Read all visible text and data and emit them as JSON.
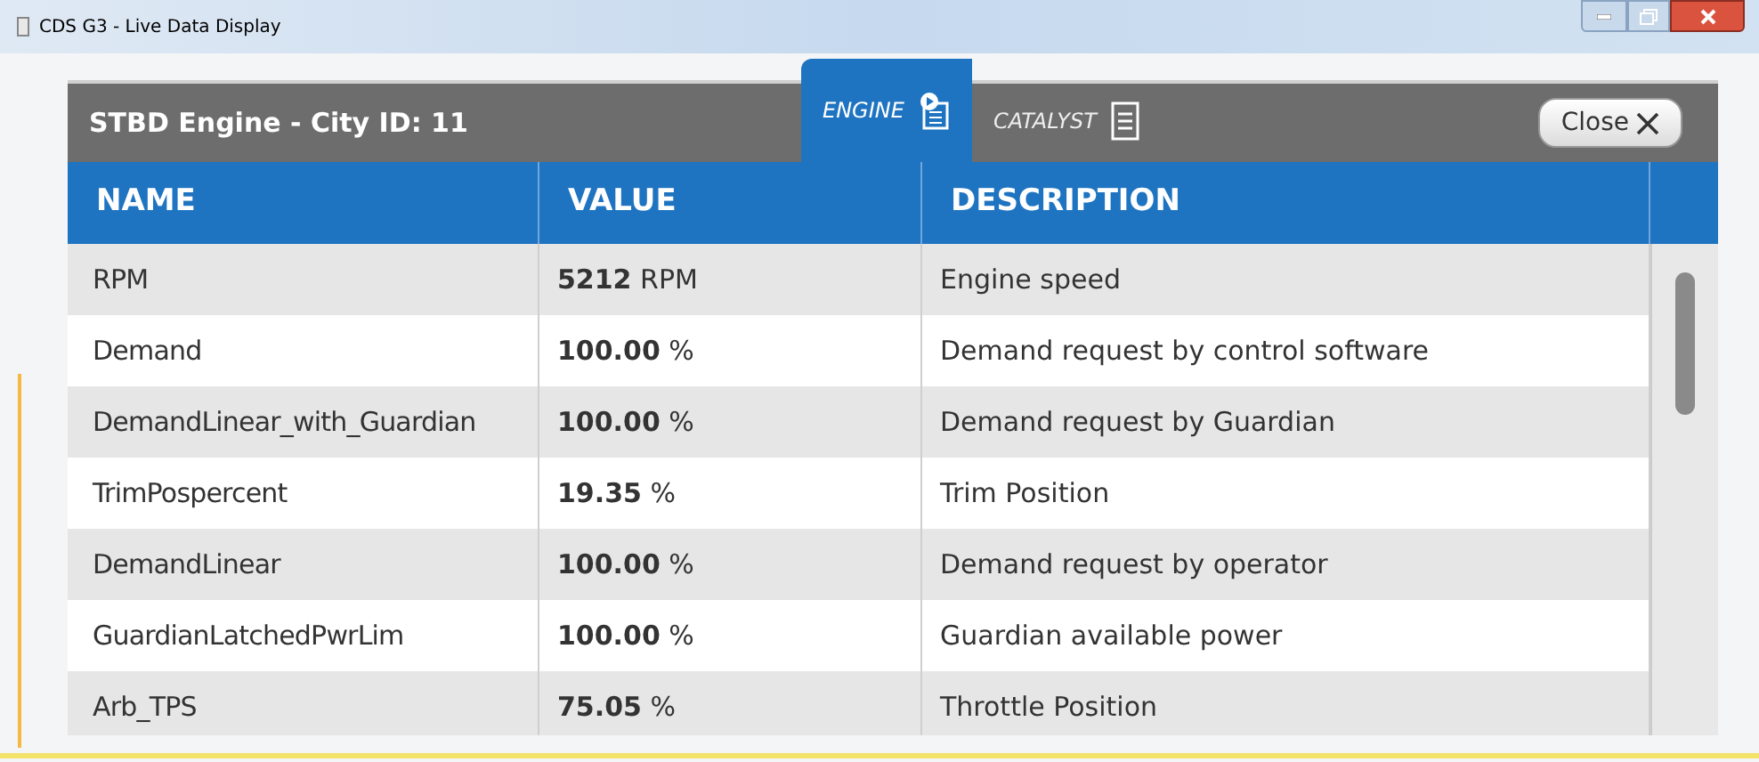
{
  "window": {
    "title": "CDS G3 - Live Data Display"
  },
  "panel": {
    "title": "STBD Engine - City ID: 11",
    "close_label": "Close"
  },
  "tabs": [
    {
      "label": "ENGINE",
      "selected": true
    },
    {
      "label": "CATALYST",
      "selected": false
    }
  ],
  "table": {
    "columns": [
      "NAME",
      "VALUE",
      "DESCRIPTION"
    ],
    "rows": [
      {
        "name": "RPM",
        "value": "**5212** RPM",
        "description": "Engine speed"
      },
      {
        "name": "Demand",
        "value": "**100.00** %",
        "description": "Demand request by control software"
      },
      {
        "name": "DemandLinear_with_Guardian",
        "value": "**100.00** %",
        "description": "Demand request by Guardian"
      },
      {
        "name": "TrimPospercent",
        "value": "**19.35** %",
        "description": "Trim Position"
      },
      {
        "name": "DemandLinear",
        "value": "**100.00** %",
        "description": "Demand request by operator"
      },
      {
        "name": "GuardianLatchedPwrLim",
        "value": "**100.00** %",
        "description": "Guardian available power"
      },
      {
        "name": "Arb_TPS",
        "value": "**75.05** %",
        "description": "Throttle Position"
      }
    ]
  }
}
